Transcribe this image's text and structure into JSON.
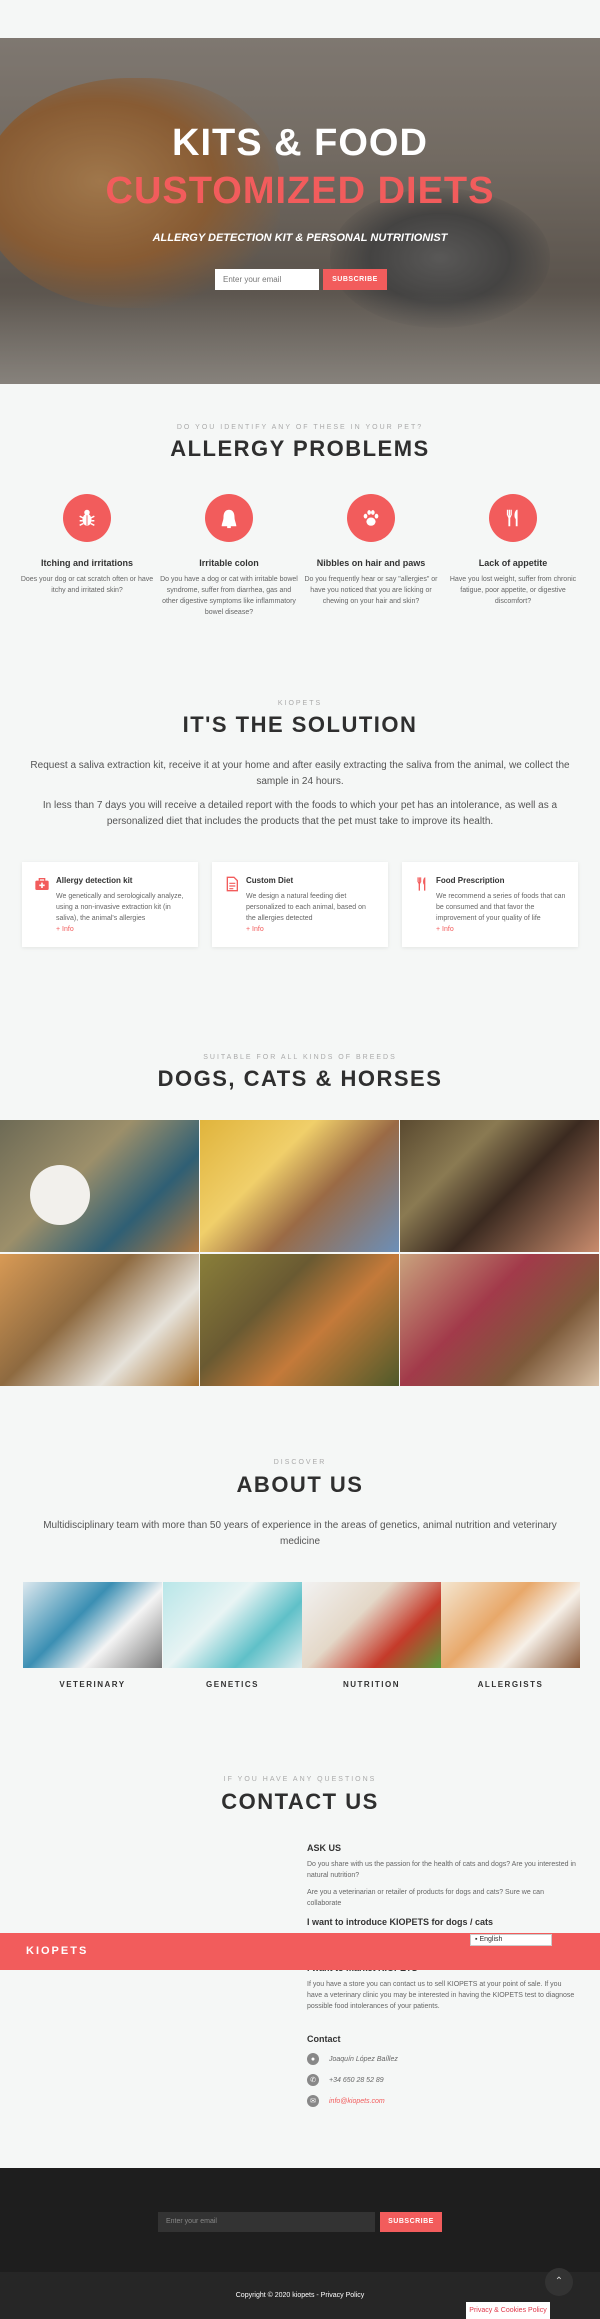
{
  "hero": {
    "title_1": "KITS & FOOD",
    "title_2": "CUSTOMIZED DIETS",
    "tagline": "ALLERGY DETECTION KIT & PERSONAL NUTRITIONIST",
    "email_placeholder": "Enter your email",
    "subscribe_label": "SUBSCRIBE"
  },
  "allergy": {
    "eyebrow": "DO YOU IDENTIFY ANY OF THESE IN YOUR PET?",
    "title": "ALLERGY PROBLEMS",
    "items": [
      {
        "icon": "bug-icon",
        "title": "Itching and irritations",
        "text": "Does your dog or cat scratch often or have itchy and irritated skin?"
      },
      {
        "icon": "stomach-icon",
        "title": "Irritable colon",
        "text": "Do you have a dog or cat with irritable bowel syndrome, suffer from diarrhea, gas and other digestive symptoms like inflammatory bowel disease?"
      },
      {
        "icon": "paw-icon",
        "title": "Nibbles on hair and paws",
        "text": "Do you frequently hear or say \"allergies\" or have you noticed that you are licking or chewing on your hair and skin?"
      },
      {
        "icon": "cutlery-icon",
        "title": "Lack of appetite",
        "text": "Have you lost weight, suffer from chronic fatigue, poor appetite, or digestive discomfort?"
      }
    ]
  },
  "solution": {
    "eyebrow": "KIOPETS",
    "title": "IT'S THE SOLUTION",
    "para_1": "Request a saliva extraction kit, receive it at your home and after easily extracting the saliva from the animal, we collect the sample in 24 hours.",
    "para_2": "In less than 7 days you will receive a detailed report with the foods to which your pet has an intolerance, as well as a personalized diet that includes the products that the pet must take to improve its health.",
    "cards": [
      {
        "icon": "medkit-icon",
        "title": "Allergy detection kit",
        "text": "We genetically and serologically analyze, using a non-invasive extraction kit (in saliva), the animal's allergies",
        "more": "+ Info"
      },
      {
        "icon": "document-icon",
        "title": "Custom Diet",
        "text": "We design a natural feeding diet personalized to each animal, based on the allergies detected",
        "more": "+ Info"
      },
      {
        "icon": "cutlery-icon",
        "title": "Food Prescription",
        "text": "We recommend a series of foods that can be consumed and that favor the improvement of your quality of life",
        "more": "+ Info"
      }
    ]
  },
  "breeds": {
    "eyebrow": "SUITABLE FOR ALL KINDS OF BREEDS",
    "title": "DOGS, CATS & HORSES"
  },
  "about": {
    "eyebrow": "DISCOVER",
    "title": "ABOUT US",
    "text": "Multidisciplinary team with more than 50 years of experience in the areas of genetics, animal nutrition and veterinary medicine",
    "team": [
      "VETERINARY",
      "GENETICS",
      "NUTRITION",
      "ALLERGISTS"
    ]
  },
  "contact": {
    "eyebrow": "IF YOU HAVE ANY QUESTIONS",
    "title": "CONTACT US",
    "ask_title": "ASK US",
    "ask_1": "Do you share with us the passion for the health of cats and dogs? Are you interested in natural nutrition?",
    "ask_2": "Are you a veterinarian or retailer of products for dogs and cats? Sure we can collaborate",
    "introduce_title": "I want to introduce KIOPETS for dogs / cats",
    "market_title": "I want to market KIOPETS",
    "market_text": "If you have a store you can contact us to sell KIOPETS at your point of sale. If you have a veterinary clinic you may be interested in having the KIOPETS test to diagnose possible food intolerances of your patients.",
    "contact_title": "Contact",
    "name": "Joaquín López Baíllez",
    "phone": "+34 650 28 52 89",
    "email": "info@kiopets.com"
  },
  "bar": {
    "logo": "KIOPETS",
    "language": "English"
  },
  "footer": {
    "email_placeholder": "Enter your email",
    "subscribe_label": "SUBSCRIBE",
    "copyright": "Copyright © 2020 kiopets - Privacy Policy",
    "privacy_button": "Privacy & Cookies Policy"
  },
  "colors": {
    "accent": "#f25c5c",
    "dark": "#1e1e1e"
  }
}
